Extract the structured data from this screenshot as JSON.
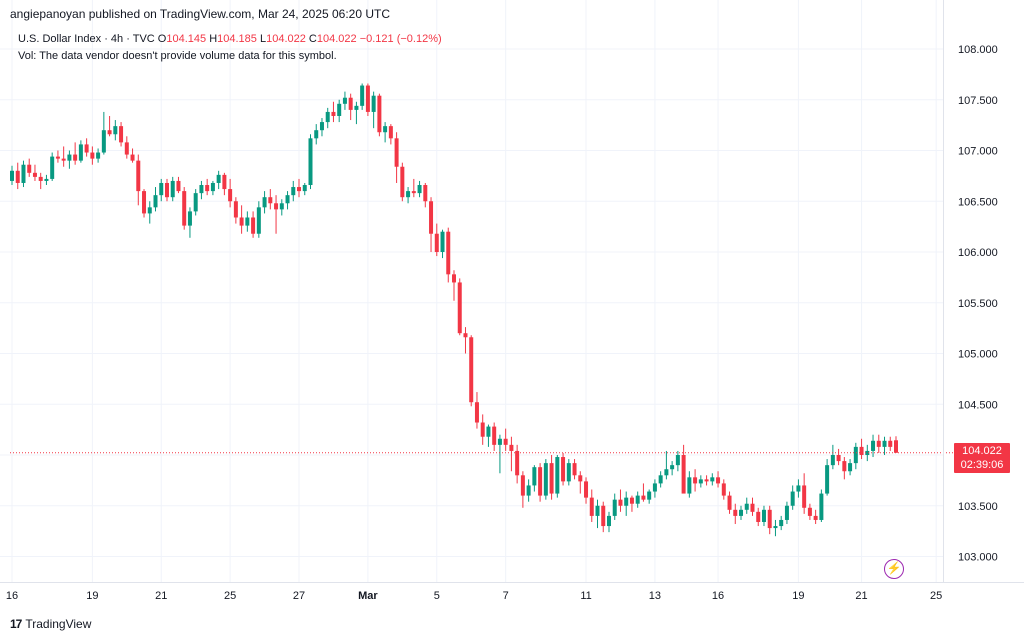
{
  "header": {
    "publisher": "angiepanoyan published on TradingView.com, Mar 24, 2025 06:20 UTC"
  },
  "legend": {
    "symbol": "U.S. Dollar Index · 4h · TVC",
    "o_label": "O",
    "o_value": "104.145",
    "h_label": "H",
    "h_value": "104.185",
    "l_label": "L",
    "l_value": "104.022",
    "c_label": "C",
    "c_value": "104.022",
    "change": "−0.121 (−0.12%)",
    "vol_note": "Vol: The data vendor doesn't provide volume data for this symbol."
  },
  "price_tag": {
    "price": "104.022",
    "countdown": "02:39:06"
  },
  "footer": {
    "brand": "TradingView",
    "logo_glyph": "17"
  },
  "icons": {
    "alert": "lightning-bolt-icon"
  },
  "colors": {
    "up": "#089981",
    "down": "#f23645",
    "grid": "#f0f3fa",
    "axis_text": "#131722",
    "last_price_line": "#f23645"
  },
  "chart_data": {
    "type": "candlestick",
    "title": "U.S. Dollar Index · 4h · TVC",
    "ylim": [
      102.75,
      108.3
    ],
    "y_ticks": [
      "103.000",
      "103.500",
      "104.000",
      "104.500",
      "105.000",
      "105.500",
      "106.000",
      "106.500",
      "107.000",
      "107.500",
      "108.000"
    ],
    "x_ticks": [
      {
        "label": "16",
        "index": 0
      },
      {
        "label": "19",
        "index": 14
      },
      {
        "label": "21",
        "index": 26
      },
      {
        "label": "25",
        "index": 38
      },
      {
        "label": "27",
        "index": 50
      },
      {
        "label": "Mar",
        "index": 62
      },
      {
        "label": "5",
        "index": 74
      },
      {
        "label": "7",
        "index": 86
      },
      {
        "label": "11",
        "index": 100
      },
      {
        "label": "13",
        "index": 112
      },
      {
        "label": "16",
        "index": 123
      },
      {
        "label": "19",
        "index": 137
      },
      {
        "label": "21",
        "index": 148
      },
      {
        "label": "25",
        "index": 161
      }
    ],
    "last_price": 104.022,
    "grid": true,
    "candles": [
      [
        106.7,
        106.85,
        106.66,
        106.8
      ],
      [
        106.8,
        106.88,
        106.62,
        106.68
      ],
      [
        106.68,
        106.9,
        106.64,
        106.86
      ],
      [
        106.86,
        106.92,
        106.74,
        106.78
      ],
      [
        106.78,
        106.86,
        106.7,
        106.74
      ],
      [
        106.74,
        106.78,
        106.62,
        106.7
      ],
      [
        106.7,
        106.76,
        106.66,
        106.72
      ],
      [
        106.72,
        106.98,
        106.7,
        106.94
      ],
      [
        106.94,
        107.0,
        106.88,
        106.92
      ],
      [
        106.92,
        107.04,
        106.84,
        106.9
      ],
      [
        106.9,
        107.0,
        106.82,
        106.96
      ],
      [
        106.96,
        107.08,
        106.86,
        106.9
      ],
      [
        106.9,
        107.1,
        106.88,
        107.06
      ],
      [
        107.06,
        107.12,
        106.94,
        106.98
      ],
      [
        106.98,
        107.04,
        106.86,
        106.92
      ],
      [
        106.92,
        107.02,
        106.88,
        106.98
      ],
      [
        106.98,
        107.38,
        106.96,
        107.2
      ],
      [
        107.2,
        107.34,
        107.14,
        107.16
      ],
      [
        107.16,
        107.3,
        107.1,
        107.24
      ],
      [
        107.24,
        107.28,
        107.04,
        107.08
      ],
      [
        107.08,
        107.14,
        106.92,
        106.96
      ],
      [
        106.96,
        107.02,
        106.88,
        106.9
      ],
      [
        106.9,
        106.96,
        106.46,
        106.6
      ],
      [
        106.6,
        106.62,
        106.34,
        106.38
      ],
      [
        106.38,
        106.5,
        106.28,
        106.44
      ],
      [
        106.44,
        106.64,
        106.4,
        106.56
      ],
      [
        106.56,
        106.72,
        106.5,
        106.68
      ],
      [
        106.68,
        106.72,
        106.5,
        106.54
      ],
      [
        106.54,
        106.74,
        106.5,
        106.7
      ],
      [
        106.7,
        106.74,
        106.58,
        106.6
      ],
      [
        106.6,
        106.64,
        106.22,
        106.26
      ],
      [
        106.26,
        106.44,
        106.14,
        106.4
      ],
      [
        106.4,
        106.62,
        106.36,
        106.58
      ],
      [
        106.58,
        106.7,
        106.52,
        106.66
      ],
      [
        106.66,
        106.72,
        106.56,
        106.6
      ],
      [
        106.6,
        106.7,
        106.56,
        106.68
      ],
      [
        106.68,
        106.8,
        106.62,
        106.76
      ],
      [
        106.76,
        106.78,
        106.56,
        106.62
      ],
      [
        106.62,
        106.72,
        106.44,
        106.5
      ],
      [
        106.5,
        106.54,
        106.28,
        106.34
      ],
      [
        106.34,
        106.46,
        106.18,
        106.26
      ],
      [
        106.26,
        106.4,
        106.2,
        106.34
      ],
      [
        106.34,
        106.4,
        106.14,
        106.18
      ],
      [
        106.18,
        106.5,
        106.14,
        106.44
      ],
      [
        106.44,
        106.6,
        106.38,
        106.54
      ],
      [
        106.54,
        106.62,
        106.42,
        106.48
      ],
      [
        106.48,
        106.56,
        106.18,
        106.42
      ],
      [
        106.42,
        106.52,
        106.36,
        106.48
      ],
      [
        106.48,
        106.6,
        106.42,
        106.56
      ],
      [
        106.56,
        106.7,
        106.5,
        106.64
      ],
      [
        106.64,
        106.72,
        106.54,
        106.6
      ],
      [
        106.6,
        106.68,
        106.56,
        106.66
      ],
      [
        106.66,
        107.16,
        106.62,
        107.12
      ],
      [
        107.12,
        107.26,
        107.06,
        107.2
      ],
      [
        107.2,
        107.32,
        107.14,
        107.28
      ],
      [
        107.28,
        107.42,
        107.22,
        107.38
      ],
      [
        107.38,
        107.48,
        107.28,
        107.34
      ],
      [
        107.34,
        107.5,
        107.28,
        107.46
      ],
      [
        107.46,
        107.58,
        107.4,
        107.52
      ],
      [
        107.52,
        107.56,
        107.3,
        107.4
      ],
      [
        107.4,
        107.48,
        107.26,
        107.44
      ],
      [
        107.44,
        107.66,
        107.4,
        107.64
      ],
      [
        107.64,
        107.66,
        107.34,
        107.38
      ],
      [
        107.38,
        107.58,
        107.22,
        107.54
      ],
      [
        107.54,
        107.56,
        107.14,
        107.18
      ],
      [
        107.18,
        107.28,
        107.08,
        107.24
      ],
      [
        107.24,
        107.26,
        107.06,
        107.12
      ],
      [
        107.12,
        107.18,
        106.68,
        106.84
      ],
      [
        106.84,
        106.88,
        106.5,
        106.54
      ],
      [
        106.54,
        106.64,
        106.48,
        106.6
      ],
      [
        106.6,
        106.72,
        106.54,
        106.58
      ],
      [
        106.58,
        106.7,
        106.54,
        106.66
      ],
      [
        106.66,
        106.68,
        106.44,
        106.5
      ],
      [
        106.5,
        106.54,
        106.0,
        106.18
      ],
      [
        106.18,
        106.28,
        105.96,
        106.0
      ],
      [
        106.0,
        106.22,
        105.94,
        106.2
      ],
      [
        106.2,
        106.24,
        105.7,
        105.78
      ],
      [
        105.78,
        105.82,
        105.52,
        105.7
      ],
      [
        105.7,
        105.74,
        105.18,
        105.2
      ],
      [
        105.2,
        105.26,
        105.0,
        105.16
      ],
      [
        105.16,
        105.18,
        104.48,
        104.52
      ],
      [
        104.52,
        104.62,
        104.26,
        104.32
      ],
      [
        104.32,
        104.4,
        104.1,
        104.18
      ],
      [
        104.18,
        104.3,
        104.08,
        104.28
      ],
      [
        104.28,
        104.32,
        104.04,
        104.1
      ],
      [
        104.1,
        104.2,
        103.82,
        104.16
      ],
      [
        104.16,
        104.26,
        104.04,
        104.1
      ],
      [
        104.1,
        104.18,
        103.84,
        104.04
      ],
      [
        104.04,
        104.1,
        103.72,
        103.8
      ],
      [
        103.8,
        103.84,
        103.48,
        103.6
      ],
      [
        103.6,
        103.76,
        103.54,
        103.7
      ],
      [
        103.7,
        103.9,
        103.64,
        103.88
      ],
      [
        103.88,
        103.92,
        103.54,
        103.6
      ],
      [
        103.6,
        103.96,
        103.56,
        103.92
      ],
      [
        103.92,
        104.0,
        103.56,
        103.62
      ],
      [
        103.62,
        104.0,
        103.58,
        103.98
      ],
      [
        103.98,
        104.02,
        103.7,
        103.74
      ],
      [
        103.74,
        103.96,
        103.7,
        103.92
      ],
      [
        103.92,
        103.96,
        103.76,
        103.8
      ],
      [
        103.8,
        103.84,
        103.62,
        103.74
      ],
      [
        103.74,
        103.78,
        103.52,
        103.58
      ],
      [
        103.58,
        103.66,
        103.34,
        103.4
      ],
      [
        103.4,
        103.56,
        103.28,
        103.5
      ],
      [
        103.5,
        103.54,
        103.24,
        103.3
      ],
      [
        103.3,
        103.44,
        103.24,
        103.4
      ],
      [
        103.4,
        103.62,
        103.36,
        103.56
      ],
      [
        103.56,
        103.66,
        103.44,
        103.5
      ],
      [
        103.5,
        103.64,
        103.4,
        103.58
      ],
      [
        103.58,
        103.6,
        103.44,
        103.52
      ],
      [
        103.52,
        103.64,
        103.48,
        103.6
      ],
      [
        103.6,
        103.72,
        103.54,
        103.56
      ],
      [
        103.56,
        103.66,
        103.52,
        103.64
      ],
      [
        103.64,
        103.76,
        103.58,
        103.72
      ],
      [
        103.72,
        103.84,
        103.68,
        103.8
      ],
      [
        103.8,
        104.04,
        103.76,
        103.86
      ],
      [
        103.86,
        103.94,
        103.8,
        103.9
      ],
      [
        103.9,
        104.04,
        103.84,
        104.0
      ],
      [
        104.0,
        104.1,
        103.92,
        103.62
      ],
      [
        103.62,
        103.84,
        103.58,
        103.78
      ],
      [
        103.78,
        103.86,
        103.64,
        103.72
      ],
      [
        103.72,
        103.8,
        103.68,
        103.76
      ],
      [
        103.76,
        103.8,
        103.7,
        103.74
      ],
      [
        103.74,
        103.82,
        103.7,
        103.78
      ],
      [
        103.78,
        103.84,
        103.68,
        103.72
      ],
      [
        103.72,
        103.76,
        103.56,
        103.6
      ],
      [
        103.6,
        103.64,
        103.42,
        103.46
      ],
      [
        103.46,
        103.52,
        103.32,
        103.4
      ],
      [
        103.4,
        103.5,
        103.36,
        103.46
      ],
      [
        103.46,
        103.58,
        103.42,
        103.52
      ],
      [
        103.52,
        103.58,
        103.4,
        103.44
      ],
      [
        103.44,
        103.48,
        103.3,
        103.34
      ],
      [
        103.34,
        103.5,
        103.3,
        103.46
      ],
      [
        103.46,
        103.5,
        103.22,
        103.28
      ],
      [
        103.28,
        103.36,
        103.2,
        103.3
      ],
      [
        103.3,
        103.4,
        103.26,
        103.36
      ],
      [
        103.36,
        103.54,
        103.32,
        103.5
      ],
      [
        103.5,
        103.7,
        103.46,
        103.64
      ],
      [
        103.64,
        103.76,
        103.58,
        103.7
      ],
      [
        103.7,
        103.82,
        103.42,
        103.48
      ],
      [
        103.48,
        103.52,
        103.36,
        103.4
      ],
      [
        103.4,
        103.46,
        103.32,
        103.36
      ],
      [
        103.36,
        103.66,
        103.34,
        103.62
      ],
      [
        103.62,
        103.96,
        103.6,
        103.9
      ],
      [
        103.9,
        104.1,
        103.86,
        104.0
      ],
      [
        104.0,
        104.06,
        103.9,
        103.94
      ],
      [
        103.94,
        103.98,
        103.76,
        103.84
      ],
      [
        103.84,
        103.96,
        103.8,
        103.92
      ],
      [
        103.92,
        104.12,
        103.86,
        104.08
      ],
      [
        104.08,
        104.16,
        103.96,
        104.0
      ],
      [
        104.0,
        104.1,
        103.94,
        104.04
      ],
      [
        104.04,
        104.2,
        103.98,
        104.14
      ],
      [
        104.14,
        104.2,
        104.02,
        104.08
      ],
      [
        104.08,
        104.18,
        104.0,
        104.14
      ],
      [
        104.14,
        104.18,
        104.04,
        104.08
      ],
      [
        104.145,
        104.185,
        104.022,
        104.022
      ]
    ]
  }
}
